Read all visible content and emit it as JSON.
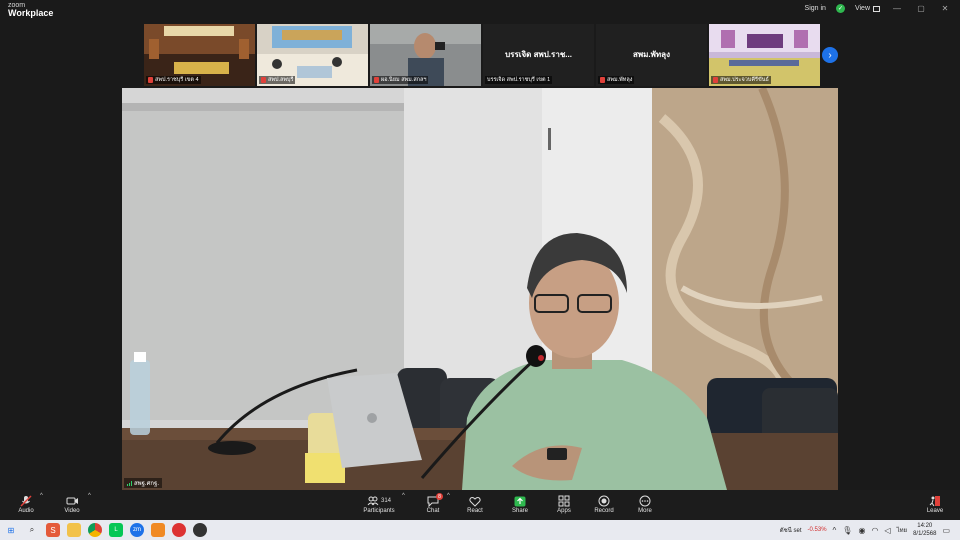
{
  "app": {
    "brand_top": "zoom",
    "brand_main": "Workplace"
  },
  "titlebar": {
    "signin": "Sign in",
    "view": "View",
    "minimize": "—",
    "maximize": "▢",
    "close": "✕"
  },
  "thumbnails": [
    {
      "caption": "สพป.ราชบุรี เขต 4",
      "muted": true,
      "kind": "video"
    },
    {
      "caption": "สพป.ลพบุรี",
      "muted": true,
      "kind": "video"
    },
    {
      "caption": "ผอ.นิยม สพม.สกลฯ",
      "muted": true,
      "kind": "video"
    },
    {
      "display_name": "บรรเจิด สพป.ราช...",
      "caption": "บรรเจิด สพป.ราชบุรี เขต 1",
      "muted": false,
      "kind": "text"
    },
    {
      "display_name": "สพม.พัทลุง",
      "caption": "สพม.พัทลุง",
      "muted": true,
      "kind": "text"
    },
    {
      "caption": "สพม.ประจวบคีรีขันธ์",
      "muted": true,
      "kind": "video"
    }
  ],
  "strip_next": "›",
  "main_video": {
    "label": "สพฐ.ศกฐ."
  },
  "toolbar": {
    "audio": "Audio",
    "video": "Video",
    "participants": "Participants",
    "participants_count": "314",
    "chat": "Chat",
    "chat_badge": "8",
    "react": "React",
    "share": "Share",
    "apps": "Apps",
    "record": "Record",
    "more": "More",
    "leave": "Leave"
  },
  "taskbar": {
    "stock_name": "ดัชนี set",
    "stock_change": "-0.53%",
    "language": "ไทย",
    "time": "14:20",
    "date": "8/1/2568"
  },
  "colors": {
    "accent": "#1e72e8",
    "muted_red": "#e0413a",
    "share_green": "#2fb84f"
  }
}
